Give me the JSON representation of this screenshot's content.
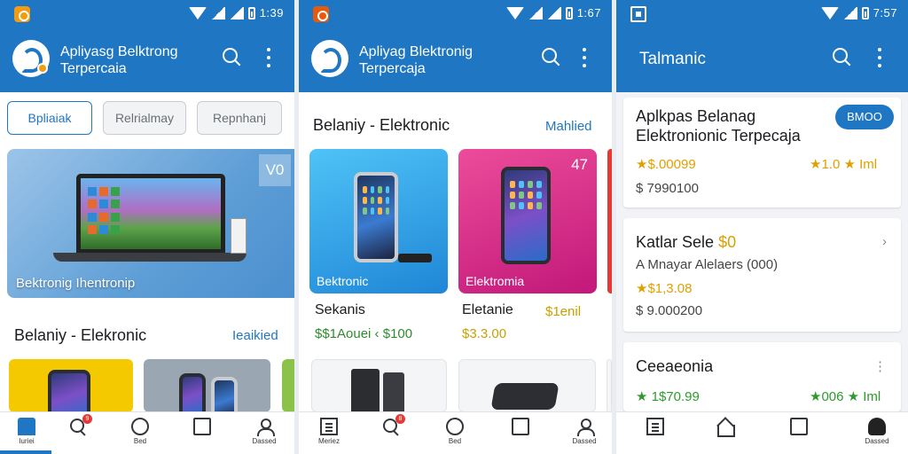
{
  "screen1": {
    "status_time": "1:39",
    "app_title_line1": "Apliyasg Belktrong",
    "app_title_line2": "Terpercaia",
    "chips": [
      "Bpliaiak",
      "Relrialmay",
      "Repnhanj"
    ],
    "banner_badge": "V0",
    "banner_label": "Bektronig Ihentronip",
    "section_title": "Belaniy - Elekronic",
    "section_link": "Ieaikied",
    "nav": [
      {
        "label": "Iuriei"
      },
      {
        "label": ""
      },
      {
        "label": "Bed"
      },
      {
        "label": ""
      },
      {
        "label": "Dassed"
      }
    ],
    "badge": "9"
  },
  "screen2": {
    "status_time": "1:67",
    "app_title_line1": "Apliyag Blektronig",
    "app_title_line2": "Terpercaja",
    "section_title": "Belaniy - Elektronic",
    "section_link": "Mahlied",
    "cards": [
      {
        "tag": "Bektronic",
        "badge": "",
        "name": "Sekanis",
        "price": "$$1Aouei ‹ $100"
      },
      {
        "tag": "Elektromia",
        "badge": "47",
        "name": "Eletanie",
        "price": "$3.3.00"
      }
    ],
    "extra_price": "$1enil",
    "nav": [
      {
        "label": "Meriez"
      },
      {
        "label": ""
      },
      {
        "label": "Bed"
      },
      {
        "label": ""
      },
      {
        "label": "Dassed"
      }
    ],
    "badge": "8"
  },
  "screen3": {
    "status_time": "7:57",
    "title": "Talmanic",
    "card1": {
      "title_line1": "Aplkpas Belanag",
      "title_line2": "Elektronionic Terpecaja",
      "button": "BMOO",
      "price": "★$.00099",
      "rating": "★1.0 ★ Iml",
      "sub": "$ 7990100"
    },
    "card2": {
      "title_prefix": "Katlar Sele",
      "title_hl": "$0",
      "line2": "A Mnayar Alelaers (000)",
      "price": "★$1,3.08",
      "sub": "$ 9.000200"
    },
    "card3": {
      "title": "Ceeaeonia",
      "price": "★ 1$70.99",
      "rating": "★006 ★ Iml"
    },
    "nav": [
      {
        "label": ""
      },
      {
        "label": ""
      },
      {
        "label": ""
      },
      {
        "label": "Dassed"
      }
    ]
  },
  "colors": {
    "primary": "#1f76c2",
    "accent_orange": "#f39c12",
    "price_green": "#2e8b2e",
    "rating_gold": "#e0a000"
  },
  "icons": [
    "wifi-icon",
    "signal-icon",
    "battery-icon",
    "search-icon",
    "more-vert-icon",
    "home-icon",
    "search-nav-icon",
    "circle-icon",
    "chat-icon",
    "profile-icon",
    "document-icon",
    "house-icon",
    "note-icon"
  ]
}
